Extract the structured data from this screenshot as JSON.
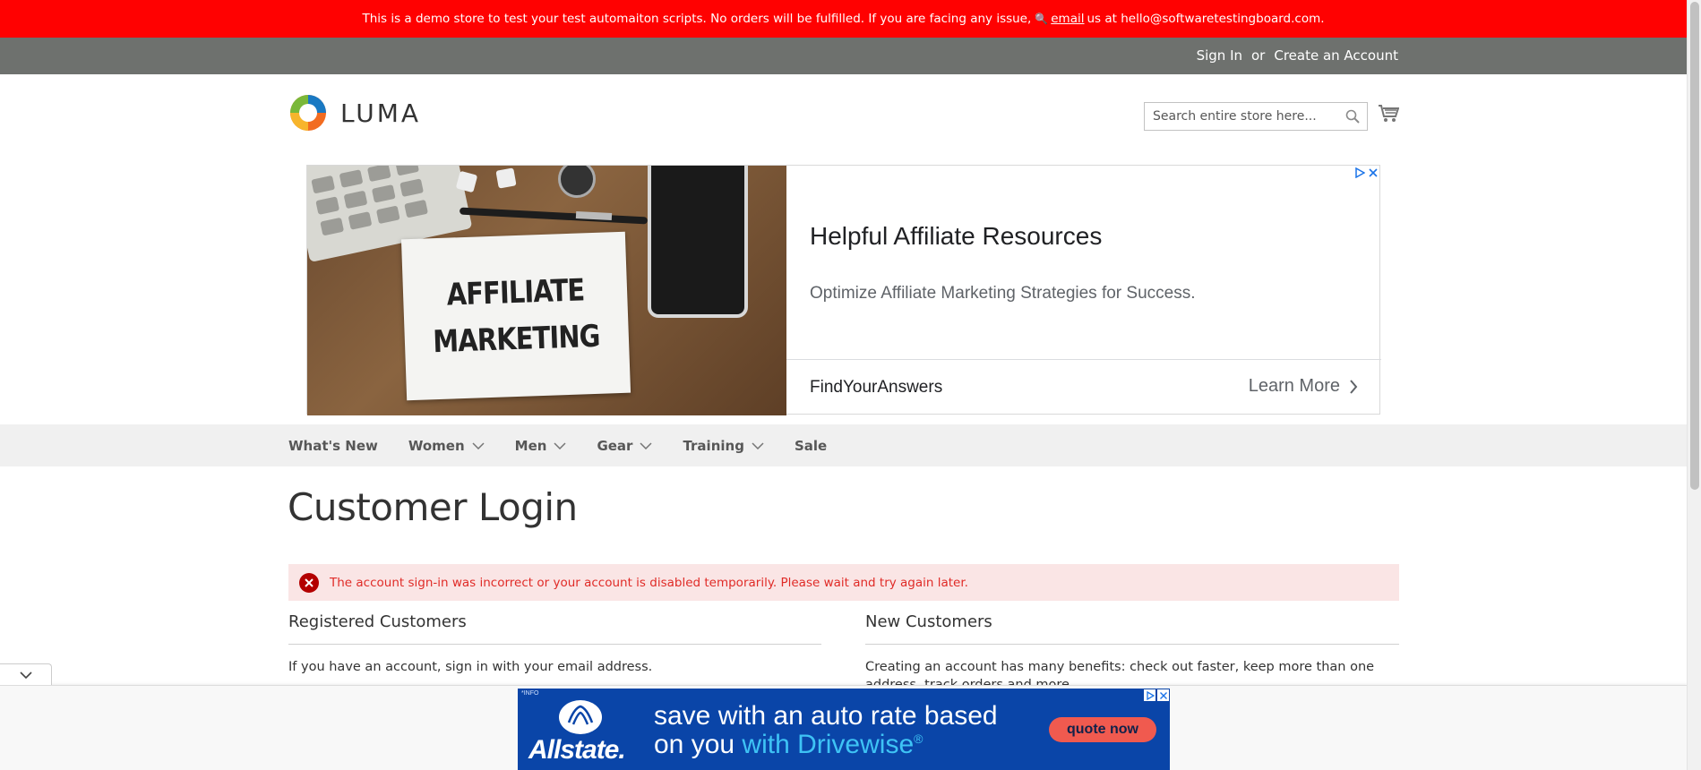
{
  "demo_notice": {
    "text_before": "This is a demo store to test your test automaiton scripts. No orders will be fulfilled. If you are facing any issue,",
    "link": "email",
    "text_after": "us at hello@softwaretestingboard.com."
  },
  "header_links": {
    "sign_in": "Sign In",
    "or": "or",
    "create_account": "Create an Account"
  },
  "logo": {
    "text": "LUMA"
  },
  "search": {
    "placeholder": "Search entire store here..."
  },
  "ad": {
    "image_text_line1": "AFFILIATE",
    "image_text_line2": "MARKETING",
    "title": "Helpful Affiliate Resources",
    "description": "Optimize Affiliate Marketing Strategies for Success.",
    "brand": "FindYourAnswers",
    "cta": "Learn More"
  },
  "nav": [
    {
      "label": "What's New",
      "has_children": false
    },
    {
      "label": "Women",
      "has_children": true
    },
    {
      "label": "Men",
      "has_children": true
    },
    {
      "label": "Gear",
      "has_children": true
    },
    {
      "label": "Training",
      "has_children": true
    },
    {
      "label": "Sale",
      "has_children": false
    }
  ],
  "page": {
    "title": "Customer Login",
    "error_message": "The account sign-in was incorrect or your account is disabled temporarily. Please wait and try again later."
  },
  "registered": {
    "title": "Registered Customers",
    "text": "If you have an account, sign in with your email address."
  },
  "new_customers": {
    "title": "New Customers",
    "text": "Creating an account has many benefits: check out faster, keep more than one address, track orders and more."
  },
  "bottom_ad": {
    "info": "*INFO",
    "brand": "Allstate.",
    "line1": "save with an auto rate based",
    "line2_plain": "on you",
    "line2_highlight": "with Drivewise",
    "registered_mark": "®",
    "button": "quote now"
  },
  "colors": {
    "demo_bar": "#ff0101",
    "header_panel": "#6e716e",
    "alert_bg": "#fae5e5",
    "alert_text": "#e02b27",
    "nav_bg": "#f0f0f0",
    "allstate_blue": "#0a45a8"
  }
}
